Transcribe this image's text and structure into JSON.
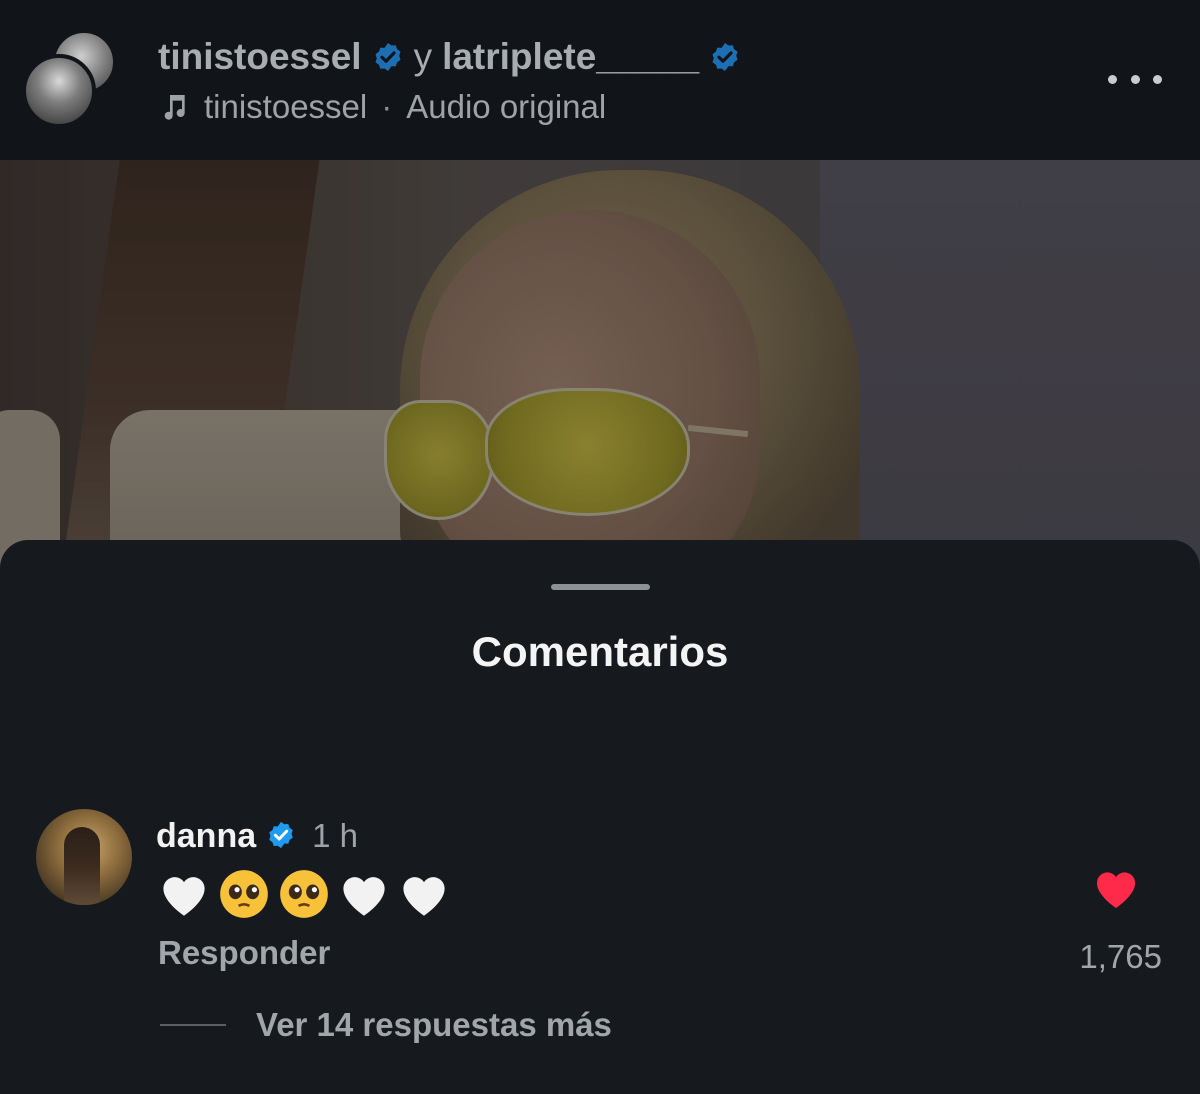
{
  "header": {
    "user1": "tinistoessel",
    "conjunction": "y",
    "user2": "latriplete_____",
    "audio_user": "tinistoessel",
    "separator": "·",
    "audio_label": "Audio original",
    "icons": [
      "avatar-stack",
      "verified-badge-icon",
      "music-note-icon",
      "more-options-icon"
    ]
  },
  "sheet": {
    "title": "Comentarios"
  },
  "comment": {
    "username": "danna",
    "time": "1 h",
    "emojis": [
      "white-heart",
      "pleading-face",
      "pleading-face",
      "white-heart",
      "white-heart"
    ],
    "reply_label": "Responder",
    "likes": "1,765",
    "view_replies": "Ver 14 respuestas más"
  },
  "colors": {
    "verified": "#1d9bf0",
    "like": "#ff2a4a",
    "sheet_bg": "#161a1f",
    "header_bg": "#111418"
  }
}
